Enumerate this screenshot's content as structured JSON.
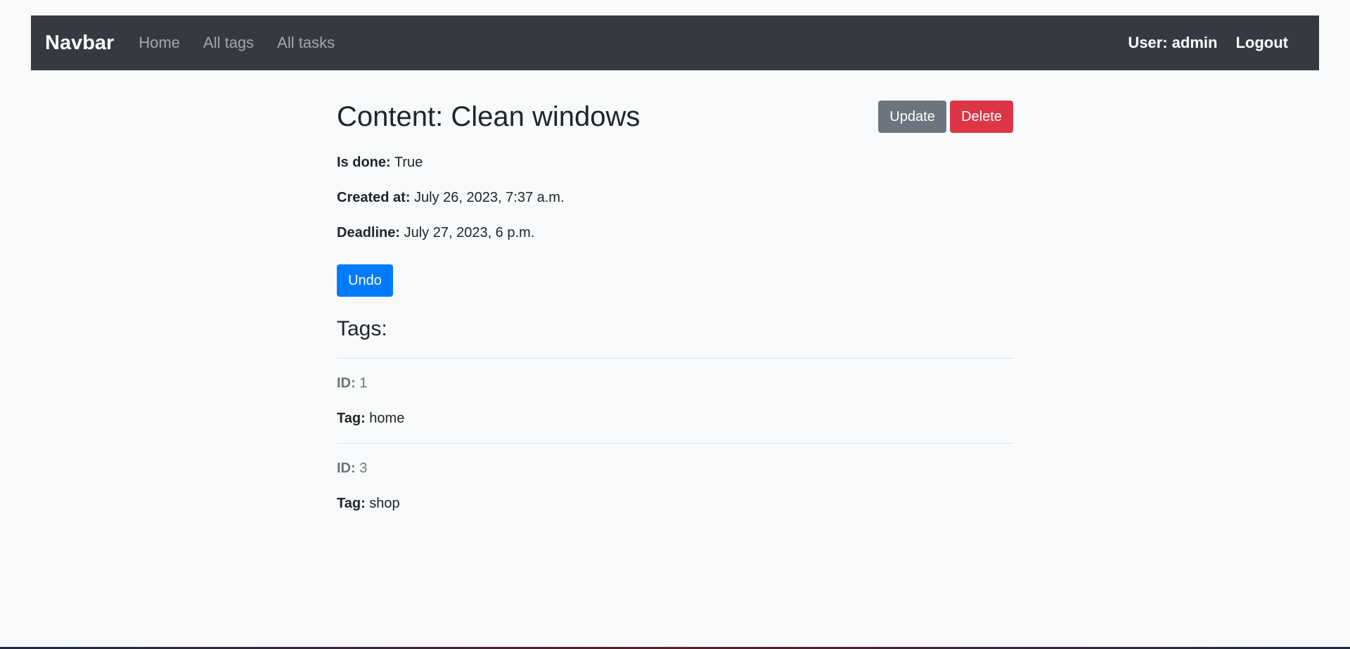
{
  "navbar": {
    "brand": "Navbar",
    "links": [
      "Home",
      "All tags",
      "All tasks"
    ],
    "user_label": "User: admin",
    "logout_label": "Logout"
  },
  "task": {
    "title": "Content: Clean windows",
    "update_label": "Update",
    "delete_label": "Delete",
    "is_done_label": "Is done:",
    "is_done_value": "True",
    "created_label": "Created at:",
    "created_value": "July 26, 2023, 7:37 a.m.",
    "deadline_label": "Deadline:",
    "deadline_value": "July 27, 2023, 6 p.m.",
    "undo_label": "Undo"
  },
  "tags": {
    "heading": "Tags:",
    "id_label": "ID:",
    "tag_label": "Tag:",
    "items": [
      {
        "id": "1",
        "name": "home"
      },
      {
        "id": "3",
        "name": "shop"
      }
    ]
  },
  "colors": {
    "navbar_bg": "#343a40",
    "update_btn": "#6c757d",
    "delete_btn": "#dc3545",
    "undo_btn": "#007bff",
    "page_bg": "#f8f9fa"
  }
}
